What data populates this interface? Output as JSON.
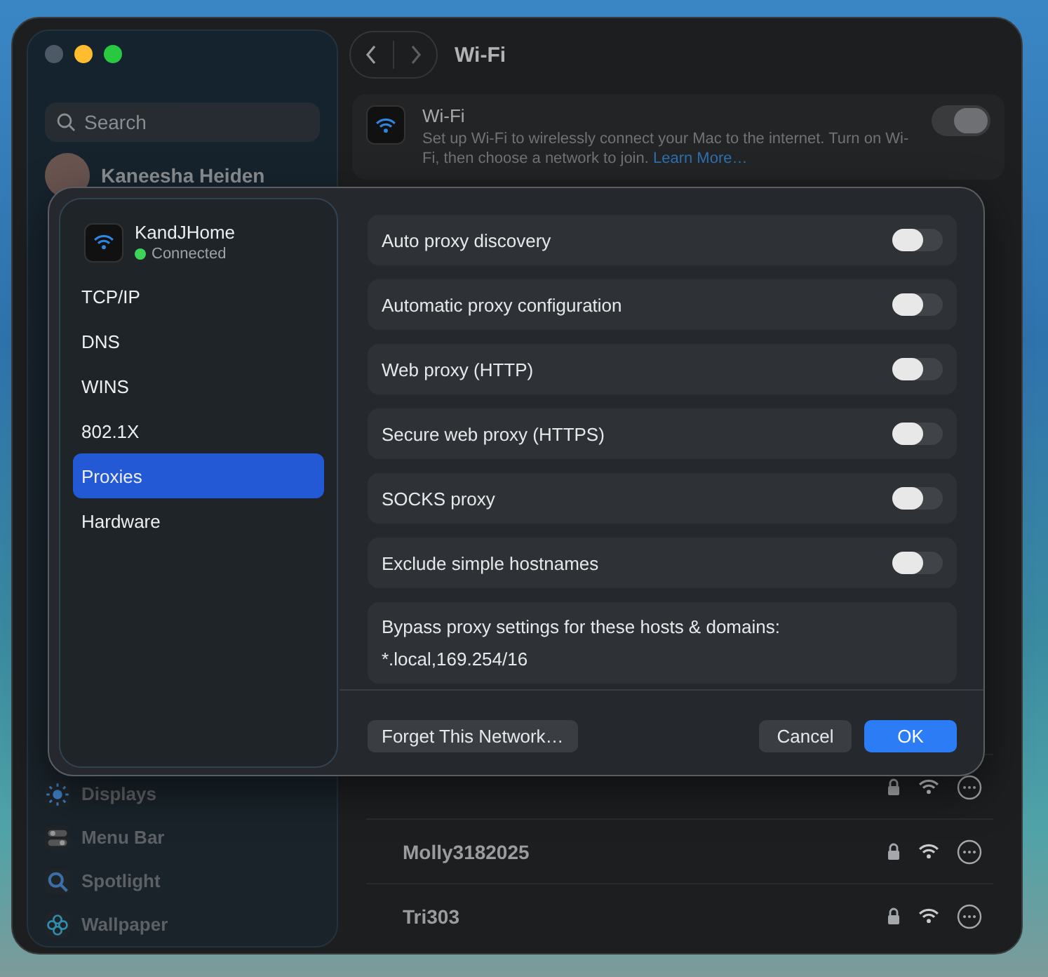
{
  "window": {
    "title": "Wi-Fi",
    "search": {
      "placeholder": "Search"
    },
    "account": {
      "name": "Kaneesha Heiden"
    },
    "sidebar_items": [
      {
        "label": "Displays",
        "kind": "sun"
      },
      {
        "label": "Menu Bar",
        "kind": "toggles"
      },
      {
        "label": "Spotlight",
        "kind": "magnifier"
      },
      {
        "label": "Wallpaper",
        "kind": "flower"
      }
    ],
    "wifi_card": {
      "title": "Wi-Fi",
      "description": "Set up Wi-Fi to wirelessly connect your Mac to the internet. Turn on Wi-Fi, then choose a network to join.",
      "link": "Learn More…",
      "on": true
    },
    "networks": [
      {
        "locked": true
      },
      {
        "name": "Molly3182025",
        "locked": true
      },
      {
        "name": "Tri303",
        "locked": true
      }
    ]
  },
  "dialog": {
    "network": {
      "name": "KandJHome",
      "status": "Connected",
      "connected": true
    },
    "tabs": [
      {
        "label": "TCP/IP",
        "selected": false
      },
      {
        "label": "DNS",
        "selected": false
      },
      {
        "label": "WINS",
        "selected": false
      },
      {
        "label": "802.1X",
        "selected": false
      },
      {
        "label": "Proxies",
        "selected": true
      },
      {
        "label": "Hardware",
        "selected": false
      }
    ],
    "toggles": [
      {
        "label": "Auto proxy discovery",
        "on": false
      },
      {
        "label": "Automatic proxy configuration",
        "on": false
      },
      {
        "label": "Web proxy (HTTP)",
        "on": false
      },
      {
        "label": "Secure web proxy (HTTPS)",
        "on": false
      },
      {
        "label": "SOCKS proxy",
        "on": false
      },
      {
        "label": "Exclude simple hostnames",
        "on": false
      }
    ],
    "bypass": {
      "label": "Bypass proxy settings for these hosts & domains:",
      "value": "*.local,169.254/16"
    },
    "buttons": [
      {
        "label": "Forget This Network…",
        "kind": "secondary"
      },
      {
        "label": "Cancel",
        "kind": "secondary"
      },
      {
        "label": "OK",
        "kind": "primary"
      }
    ]
  }
}
